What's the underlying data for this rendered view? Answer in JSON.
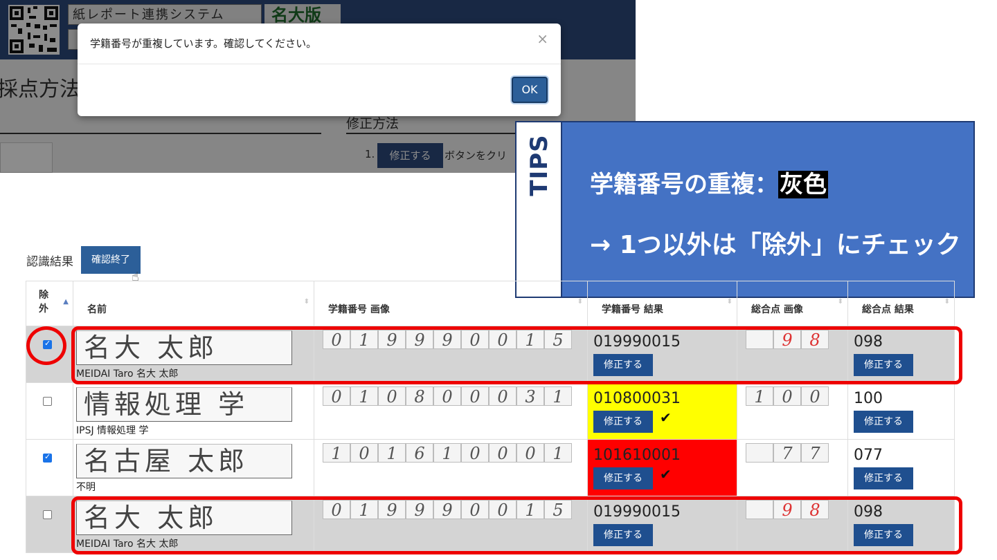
{
  "header": {
    "logo_text": "紙レポート連携システム",
    "edition": "名大版"
  },
  "background": {
    "section_title": "採点方法",
    "fix_method_title": "修正方法",
    "step_number": "1.",
    "step_button": "修正する",
    "step_text": "ボタンをクリ"
  },
  "modal": {
    "message": "学籍番号が重複しています。確認してください。",
    "close": "×",
    "ok_label": "OK"
  },
  "tips": {
    "label": "TIPS",
    "line1_prefix": "学籍番号の重複：",
    "line1_highlight": "灰色",
    "line2": "→ 1つ以外は「除外」にチェック"
  },
  "results": {
    "label": "認識結果",
    "confirm_button": "確認終了",
    "columns": [
      "除外",
      "名前",
      "学籍番号 画像",
      "学籍番号 結果",
      "総合点 画像",
      "総合点 結果"
    ],
    "fix_label": "修正する",
    "rows": [
      {
        "excluded": true,
        "handwritten_name": "名大 太郎",
        "name": "MEIDAI Taro 名大 太郎",
        "id_digits": [
          "0",
          "1",
          "9",
          "9",
          "9",
          "0",
          "0",
          "1",
          "5"
        ],
        "id_result": "019990015",
        "score_digits": [
          "",
          "9",
          "8"
        ],
        "score_result": "098",
        "status": "duplicate"
      },
      {
        "excluded": false,
        "handwritten_name": "情報処理 学",
        "name": "IPSJ 情報処理 学",
        "id_digits": [
          "0",
          "1",
          "0",
          "8",
          "0",
          "0",
          "0",
          "3",
          "1"
        ],
        "id_result": "010800031",
        "score_digits": [
          "1",
          "0",
          "0"
        ],
        "score_result": "100",
        "status": "warning"
      },
      {
        "excluded": true,
        "handwritten_name": "名古屋 太郎",
        "name": "不明",
        "id_digits": [
          "1",
          "0",
          "1",
          "6",
          "1",
          "0",
          "0",
          "0",
          "1"
        ],
        "id_result": "101610001",
        "score_digits": [
          "",
          "7",
          "7"
        ],
        "score_result": "077",
        "status": "error"
      },
      {
        "excluded": false,
        "handwritten_name": "名大 太郎",
        "name": "MEIDAI Taro 名大 太郎",
        "id_digits": [
          "0",
          "1",
          "9",
          "9",
          "9",
          "0",
          "0",
          "1",
          "5"
        ],
        "id_result": "019990015",
        "score_digits": [
          "",
          "9",
          "8"
        ],
        "score_result": "098",
        "status": "duplicate"
      }
    ]
  }
}
